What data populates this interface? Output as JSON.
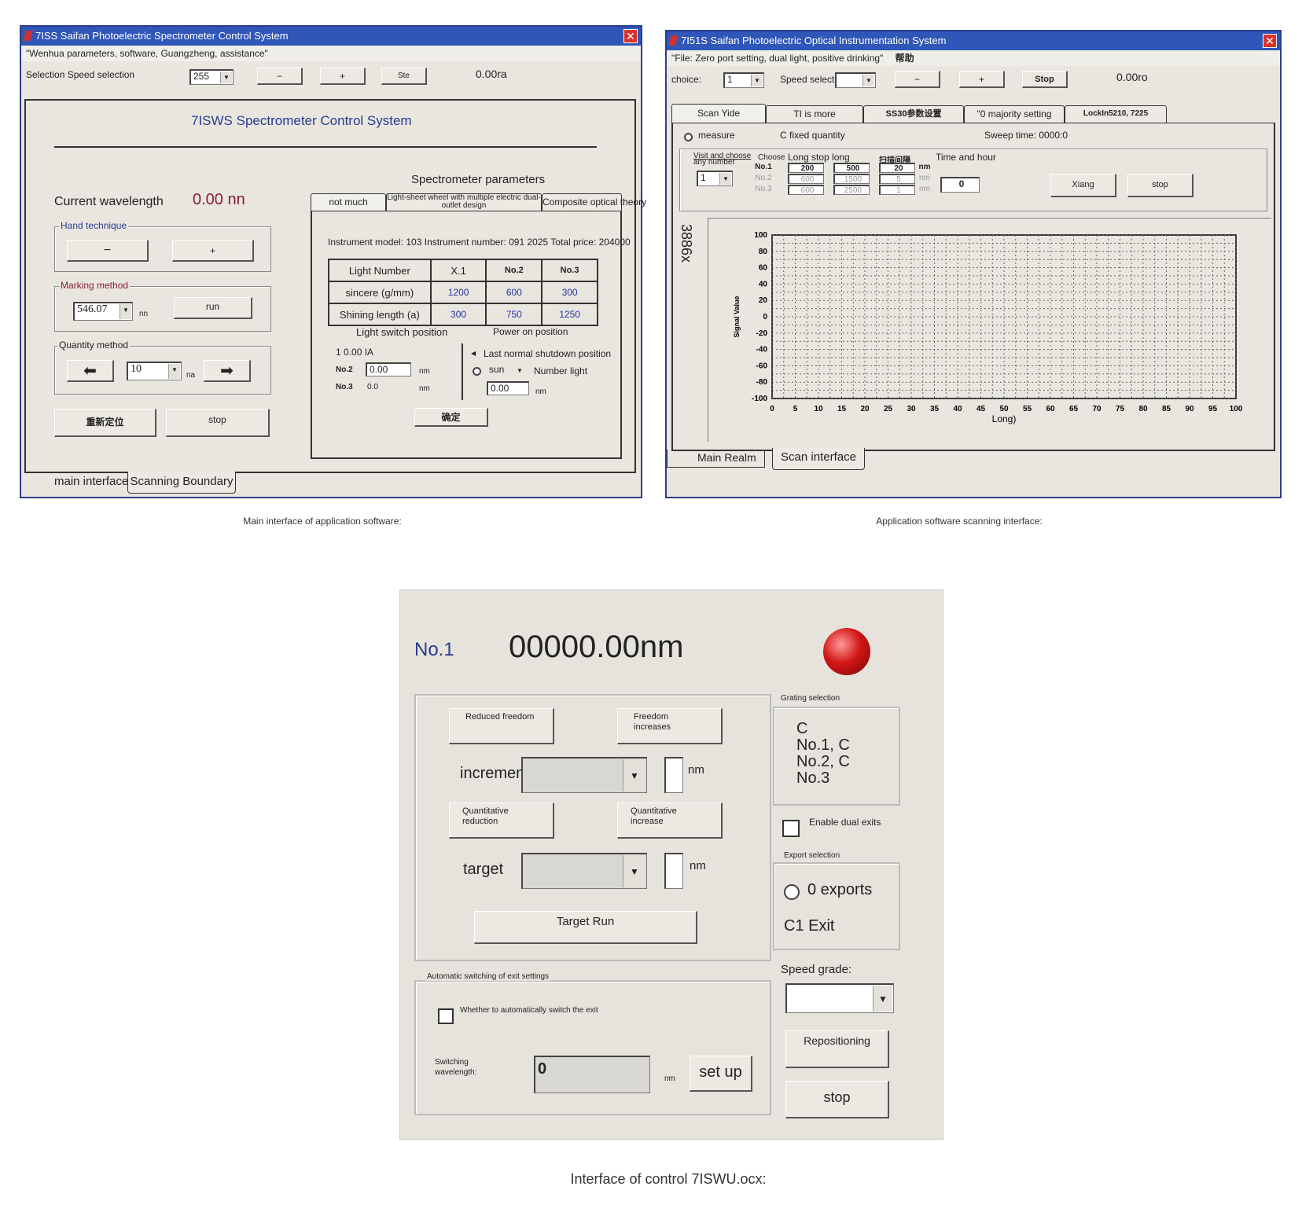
{
  "main": {
    "title": "7ISS Saifan Photoelectric Spectrometer Control System",
    "menu": "\"Wenhua parameters, software, Guangzheng, assistance\"",
    "toolbar": {
      "label": "Selection Speed selection",
      "speed_value": "255",
      "minus": "−",
      "plus": "+",
      "stop": "Ste",
      "readout": "0.00ra"
    },
    "heading": "7ISWS Spectrometer Control System",
    "current_wavelength_label": "Current wavelength",
    "current_wavelength_value": "0.00 nn",
    "hand_group": "Hand technique",
    "hand_minus": "−",
    "hand_plus": "+",
    "marking_group": "Marking method",
    "marking_value": "546.07",
    "marking_unit": "nn",
    "run": "run",
    "quantity_group": "Quantity method",
    "quantity_value": "10",
    "quantity_unit": "na",
    "reset_button": "重新定位",
    "stop_button": "stop",
    "params_title": "Spectrometer parameters",
    "tabs": [
      "not much",
      "Light-sheet wheel with multiple electric dual-outlet design",
      "Composite optical theory"
    ],
    "instrument_line": "Instrument model: 103 Instrument number: 091 2025 Total price: 204000",
    "table": {
      "header": [
        "Light Number",
        "X.1",
        "No.2",
        "No.3"
      ],
      "rows": [
        [
          "sincere (g/mm)",
          "1200",
          "600",
          "300"
        ],
        [
          "Shining length (a)",
          "300",
          "750",
          "1250"
        ]
      ]
    },
    "light_switch_title": "Light switch position",
    "power_on_title": "Power on position",
    "ls_line1": "1  0.00 IA",
    "ls_no2": "No.2",
    "ls_no2_value": "0.00",
    "ls_no3": "No.3",
    "ls_no3_value": "0.0",
    "ls_unit": "nm",
    "last_shutdown": "Last normal shutdown position",
    "sun": "sun",
    "number_light": "Number light",
    "po_value": "0.00",
    "po_unit": "nm",
    "confirm": "确定",
    "bottom_tabs": [
      "main interface",
      "Scanning Boundary"
    ]
  },
  "scan": {
    "title": "7I51S Saifan Photoelectric Optical Instrumentation System",
    "menu": "\"File: Zero port setting, dual light, positive drinking\"",
    "menu_extra": "帮助",
    "toolbar": {
      "choice_label": "choice:",
      "choice_value": "1",
      "speed_label": "Speed selection:",
      "minus": "−",
      "plus": "+",
      "stop": "Stop",
      "readout": "0.00ro"
    },
    "tabs": [
      "Scan Yide",
      "TI is more",
      "SS30参数设置",
      "\"0 majority setting",
      "LockIn5210, 7225"
    ],
    "measure": "measure",
    "fixed_quantity": "C fixed quantity",
    "sweep_time": "Sweep time: 0000:0",
    "visit_choose": "Visit and choose",
    "any_number": "any number",
    "choose": "Choose",
    "long_stop_long": "Long stop long",
    "scan_step": "扫描间隔",
    "time_hour": "Time and hour",
    "grating_sel": "1",
    "rows": [
      {
        "label": "No.1",
        "start": "200",
        "stop": "500",
        "step": "20",
        "unit": "nm"
      },
      {
        "label": "No.2",
        "start": "600",
        "stop": "1500",
        "step": "5",
        "unit": "nm"
      },
      {
        "label": "No.3",
        "start": "600",
        "stop": "2500",
        "step": "1",
        "unit": "nm"
      }
    ],
    "time_value": "0",
    "xiang": "Xiang",
    "stop": "stop",
    "side_label": "3886x",
    "bottom_tabs": [
      "Main Realm",
      "Scan interface"
    ]
  },
  "chart_data": {
    "type": "line",
    "title": "",
    "xlabel": "Long)",
    "ylabel": "Signal Value",
    "xlim": [
      0,
      100
    ],
    "ylim": [
      -100,
      100
    ],
    "x_ticks": [
      "0",
      "5",
      "10",
      "15",
      "20",
      "25",
      "30",
      "35",
      "40",
      "45",
      "50",
      "55",
      "60",
      "65",
      "70",
      "75",
      "80",
      "85",
      "90",
      "95",
      "100"
    ],
    "y_ticks": [
      "100",
      "80",
      "60",
      "40",
      "20",
      "0",
      "-20",
      "-40",
      "-60",
      "-80",
      "-100"
    ],
    "grid": true,
    "series": []
  },
  "captions": {
    "main": "Main interface of application software:",
    "scan": "Application software scanning interface:",
    "ocx": "Interface of control 7ISWU.ocx:"
  },
  "ocx": {
    "channel": "No.1",
    "wavelength": "00000.00nm",
    "indicator_color": "#d21616",
    "reduced_freedom": "Reduced freedom",
    "freedom_increases": "Freedom increases",
    "increment_label": "increment",
    "increment_unit": "nm",
    "quant_reduction": "Quantitative reduction",
    "quant_increase": "Quantitative increase",
    "target_label": "target",
    "target_unit": "nm",
    "target_run": "Target Run",
    "auto_switch_group": "Automatic switching of exit settings",
    "auto_switch_check": "Whether to automatically switch the exit",
    "switching_wavelength": "Switching wavelength:",
    "switch_value": "0",
    "switch_unit": "nm",
    "set_up": "set up",
    "grating_group": "Grating selection",
    "grating_options": [
      "C",
      "No.1, C",
      "No.2, C",
      "No.3"
    ],
    "enable_dual": "Enable dual exits",
    "export_group": "Export selection",
    "exports": "0 exports",
    "exit1": "C1 Exit",
    "speed_grade": "Speed grade:",
    "repositioning": "Repositioning",
    "stop": "stop"
  }
}
